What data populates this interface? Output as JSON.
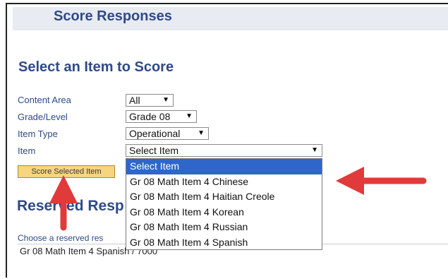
{
  "header": {
    "title": "Score Responses"
  },
  "section": {
    "title": "Select an Item to Score"
  },
  "form": {
    "content_area": {
      "label": "Content Area",
      "value": "All"
    },
    "grade_level": {
      "label": "Grade/Level",
      "value": "Grade 08"
    },
    "item_type": {
      "label": "Item Type",
      "value": "Operational"
    },
    "item": {
      "label": "Item",
      "value": "Select Item"
    },
    "score_button": "Score Selected Item"
  },
  "dropdown": {
    "options": [
      "Select Item",
      "Gr 08 Math Item 4 Chinese",
      "Gr 08 Math Item 4 Haitian Creole",
      "Gr 08 Math Item 4 Korean",
      "Gr 08 Math Item 4 Russian",
      "Gr 08 Math Item 4 Spanish"
    ]
  },
  "reserved": {
    "title": "Reserved Resp",
    "subtitle": "Choose a reserved res",
    "entry": "Gr 08 Math Item 4 Spanish / 7000"
  },
  "colors": {
    "accent_text": "#2f4a86",
    "button_bg": "#f6d57e",
    "selected_option": "#2e67c9",
    "annotation_arrow": "#e03a3a"
  },
  "icons": {
    "select_arrow": "triangle-down-icon",
    "annotation": "red-arrow-icon"
  }
}
